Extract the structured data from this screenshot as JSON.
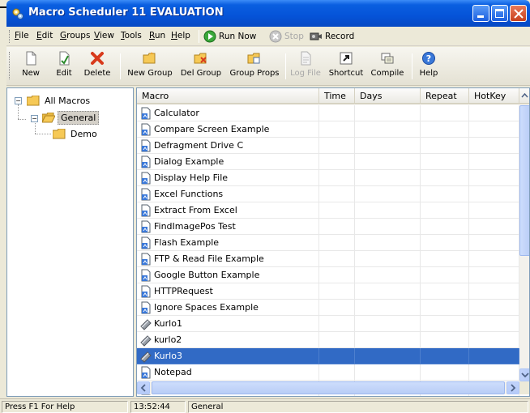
{
  "window": {
    "title": "Macro Scheduler 11 EVALUATION",
    "caption_buttons": [
      "minimize-icon",
      "maximize-icon",
      "close-icon"
    ]
  },
  "menu": {
    "items": [
      {
        "label": "File",
        "ul": "F",
        "rest": "ile"
      },
      {
        "label": "Edit",
        "ul": "E",
        "rest": "dit"
      },
      {
        "label": "Groups",
        "ul": "G",
        "rest": "roups"
      },
      {
        "label": "View",
        "ul": "V",
        "rest": "iew"
      },
      {
        "label": "Tools",
        "ul": "T",
        "rest": "ools"
      },
      {
        "label": "Run",
        "ul": "R",
        "rest": "un"
      },
      {
        "label": "Help",
        "ul": "H",
        "rest": "elp"
      }
    ],
    "run_now": "Run Now",
    "stop": "Stop",
    "record": "Record"
  },
  "toolbar": {
    "new": "New",
    "edit": "Edit",
    "delete": "Delete",
    "new_group": "New Group",
    "del_group": "Del Group",
    "group_props": "Group Props",
    "log_file": "Log File",
    "shortcut": "Shortcut",
    "compile": "Compile",
    "help": "Help"
  },
  "tree": {
    "root": "All Macros",
    "general": "General",
    "demo": "Demo"
  },
  "list": {
    "columns": [
      "Macro",
      "Time",
      "Days",
      "Repeat",
      "HotKey"
    ],
    "rows": [
      {
        "name": "Calculator",
        "icon": "macro-file-icon"
      },
      {
        "name": "Compare Screen Example",
        "icon": "macro-file-icon"
      },
      {
        "name": "Defragment Drive C",
        "icon": "macro-file-icon"
      },
      {
        "name": "Dialog Example",
        "icon": "macro-file-icon"
      },
      {
        "name": "Display Help File",
        "icon": "macro-file-icon"
      },
      {
        "name": "Excel Functions",
        "icon": "macro-file-icon"
      },
      {
        "name": "Extract From Excel",
        "icon": "macro-file-icon"
      },
      {
        "name": "FindImagePos Test",
        "icon": "macro-file-icon"
      },
      {
        "name": "Flash Example",
        "icon": "macro-file-icon"
      },
      {
        "name": "FTP & Read File Example",
        "icon": "macro-file-icon"
      },
      {
        "name": "Google Button Example",
        "icon": "macro-file-icon"
      },
      {
        "name": "HTTPRequest",
        "icon": "macro-file-icon"
      },
      {
        "name": "Ignore Spaces Example",
        "icon": "macro-file-icon"
      },
      {
        "name": "Kurlo1",
        "icon": "compiled-macro-icon"
      },
      {
        "name": "kurlo2",
        "icon": "compiled-macro-icon"
      },
      {
        "name": "Kurlo3",
        "icon": "compiled-macro-icon",
        "selected": true
      },
      {
        "name": "Notepad",
        "icon": "macro-file-icon"
      },
      {
        "name": "",
        "icon": "macro-file-icon"
      }
    ]
  },
  "status": {
    "help": "Press F1 For Help",
    "time": "13:52:44",
    "group": "General"
  },
  "colors": {
    "titlebar": "#0553d8",
    "selection": "#316ac5",
    "chrome": "#ece9d8"
  }
}
